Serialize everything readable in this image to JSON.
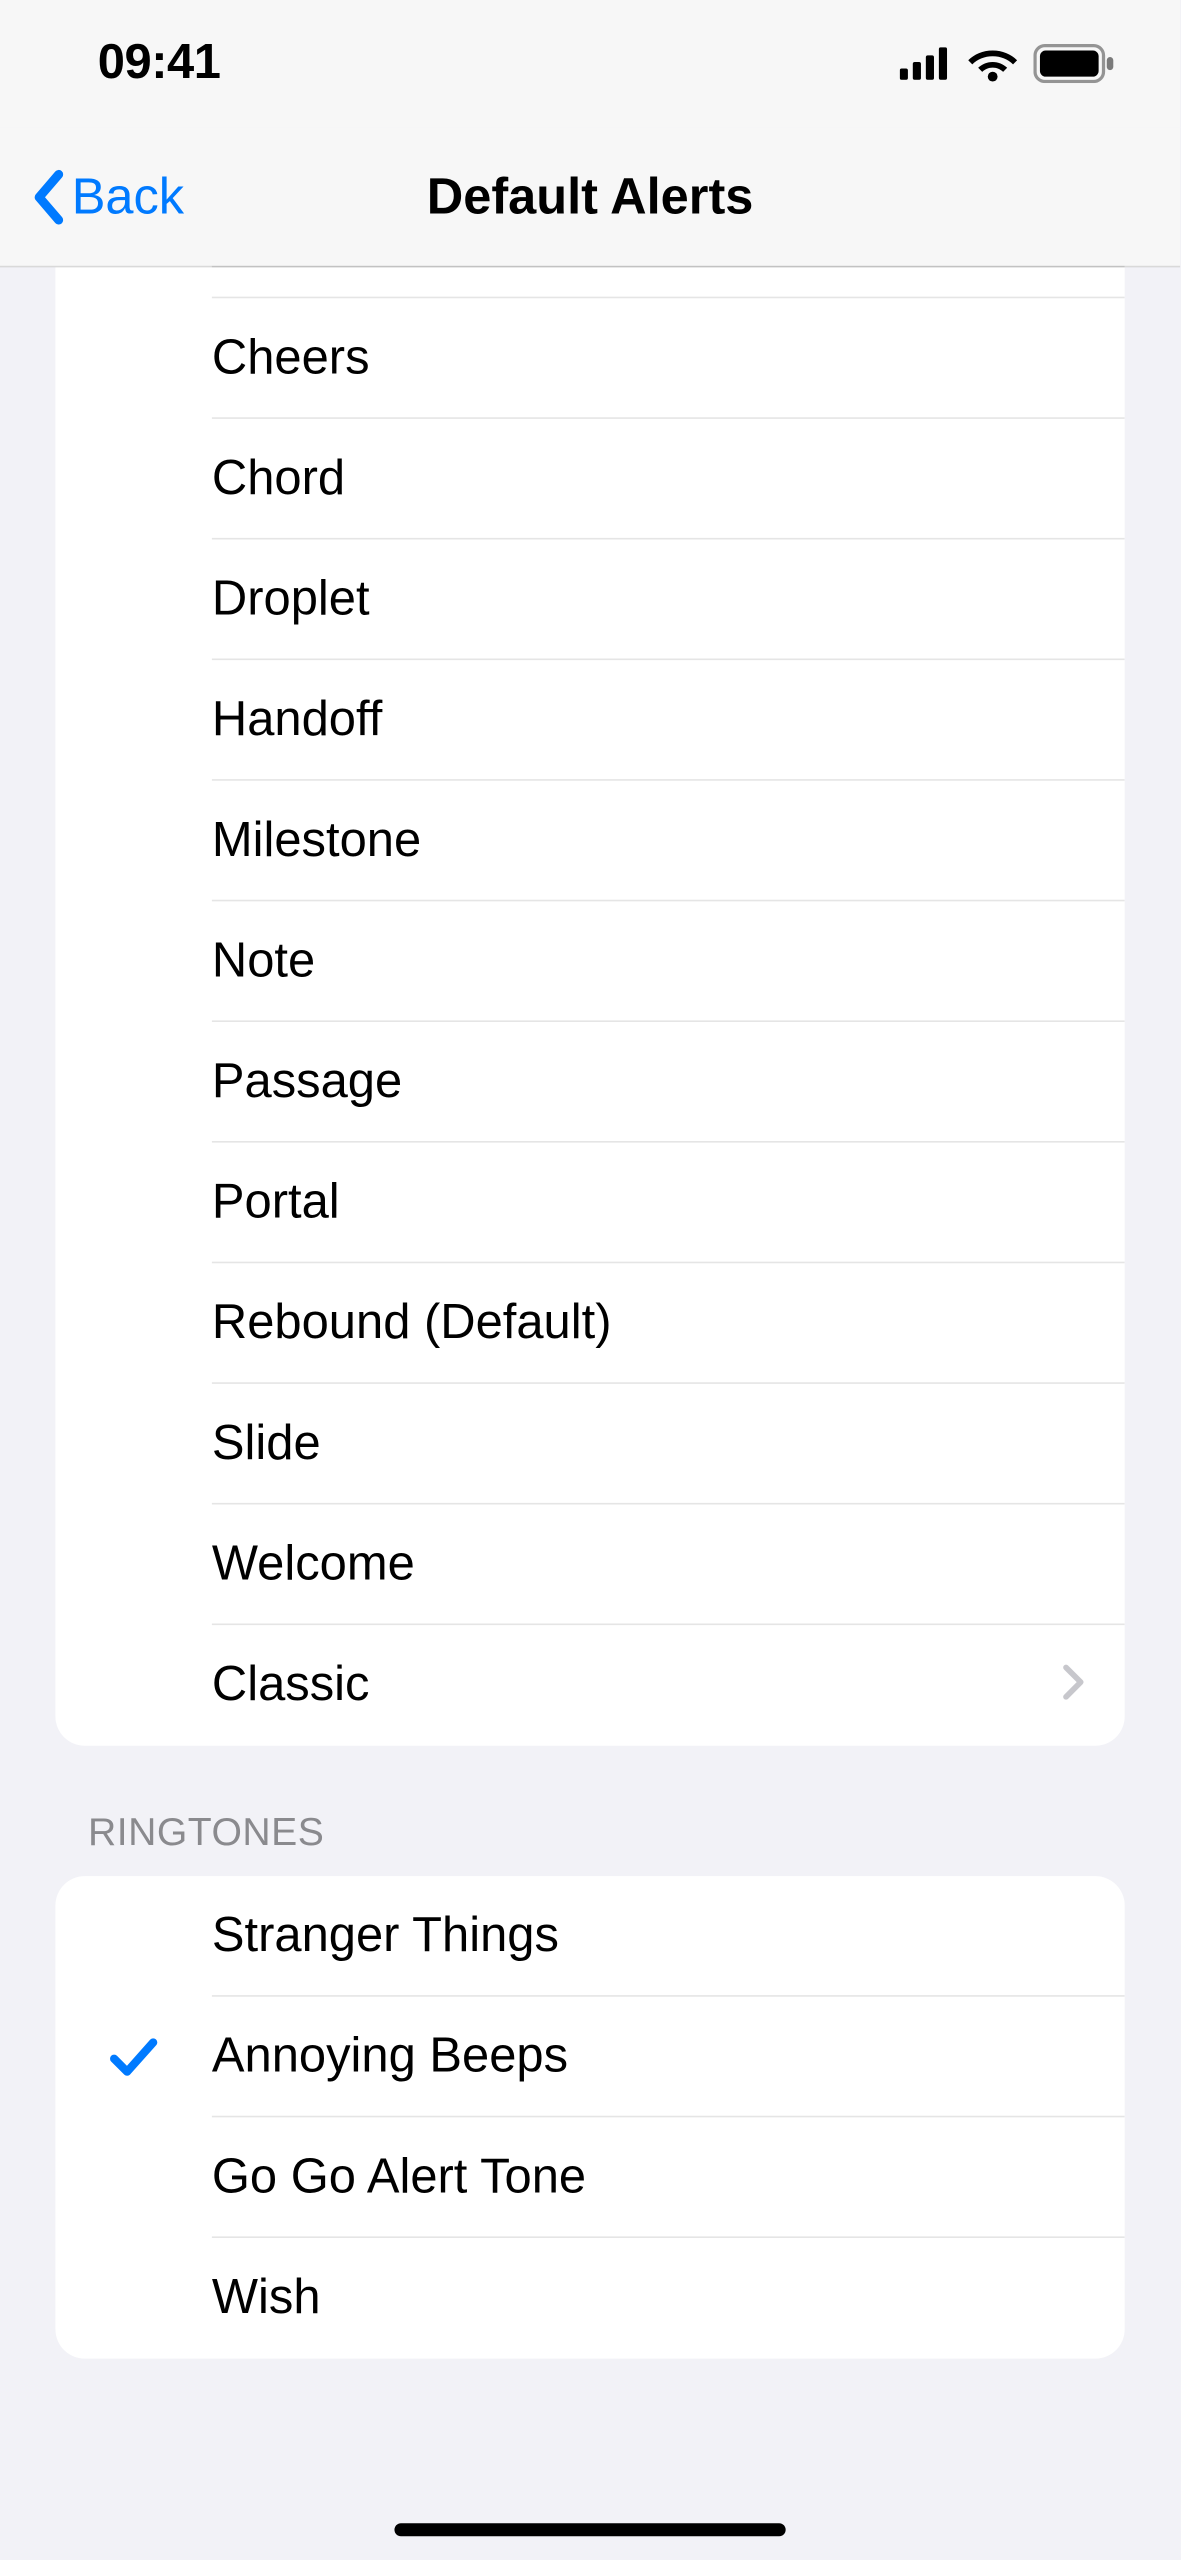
{
  "statusbar": {
    "time": "09:41"
  },
  "navbar": {
    "back_label": "Back",
    "title": "Default Alerts"
  },
  "groups": [
    {
      "items": [
        {
          "label": "Cheers",
          "selected": false,
          "disclosure": false
        },
        {
          "label": "Chord",
          "selected": false,
          "disclosure": false
        },
        {
          "label": "Droplet",
          "selected": false,
          "disclosure": false
        },
        {
          "label": "Handoff",
          "selected": false,
          "disclosure": false
        },
        {
          "label": "Milestone",
          "selected": false,
          "disclosure": false
        },
        {
          "label": "Note",
          "selected": false,
          "disclosure": false
        },
        {
          "label": "Passage",
          "selected": false,
          "disclosure": false
        },
        {
          "label": "Portal",
          "selected": false,
          "disclosure": false
        },
        {
          "label": "Rebound (Default)",
          "selected": false,
          "disclosure": false
        },
        {
          "label": "Slide",
          "selected": false,
          "disclosure": false
        },
        {
          "label": "Welcome",
          "selected": false,
          "disclosure": false
        },
        {
          "label": "Classic",
          "selected": false,
          "disclosure": true
        }
      ]
    },
    {
      "header": "RINGTONES",
      "items": [
        {
          "label": "Stranger Things",
          "selected": false,
          "disclosure": false
        },
        {
          "label": "Annoying Beeps",
          "selected": true,
          "disclosure": false
        },
        {
          "label": "Go Go Alert Tone",
          "selected": false,
          "disclosure": false
        },
        {
          "label": "Wish",
          "selected": false,
          "disclosure": false
        }
      ]
    }
  ]
}
